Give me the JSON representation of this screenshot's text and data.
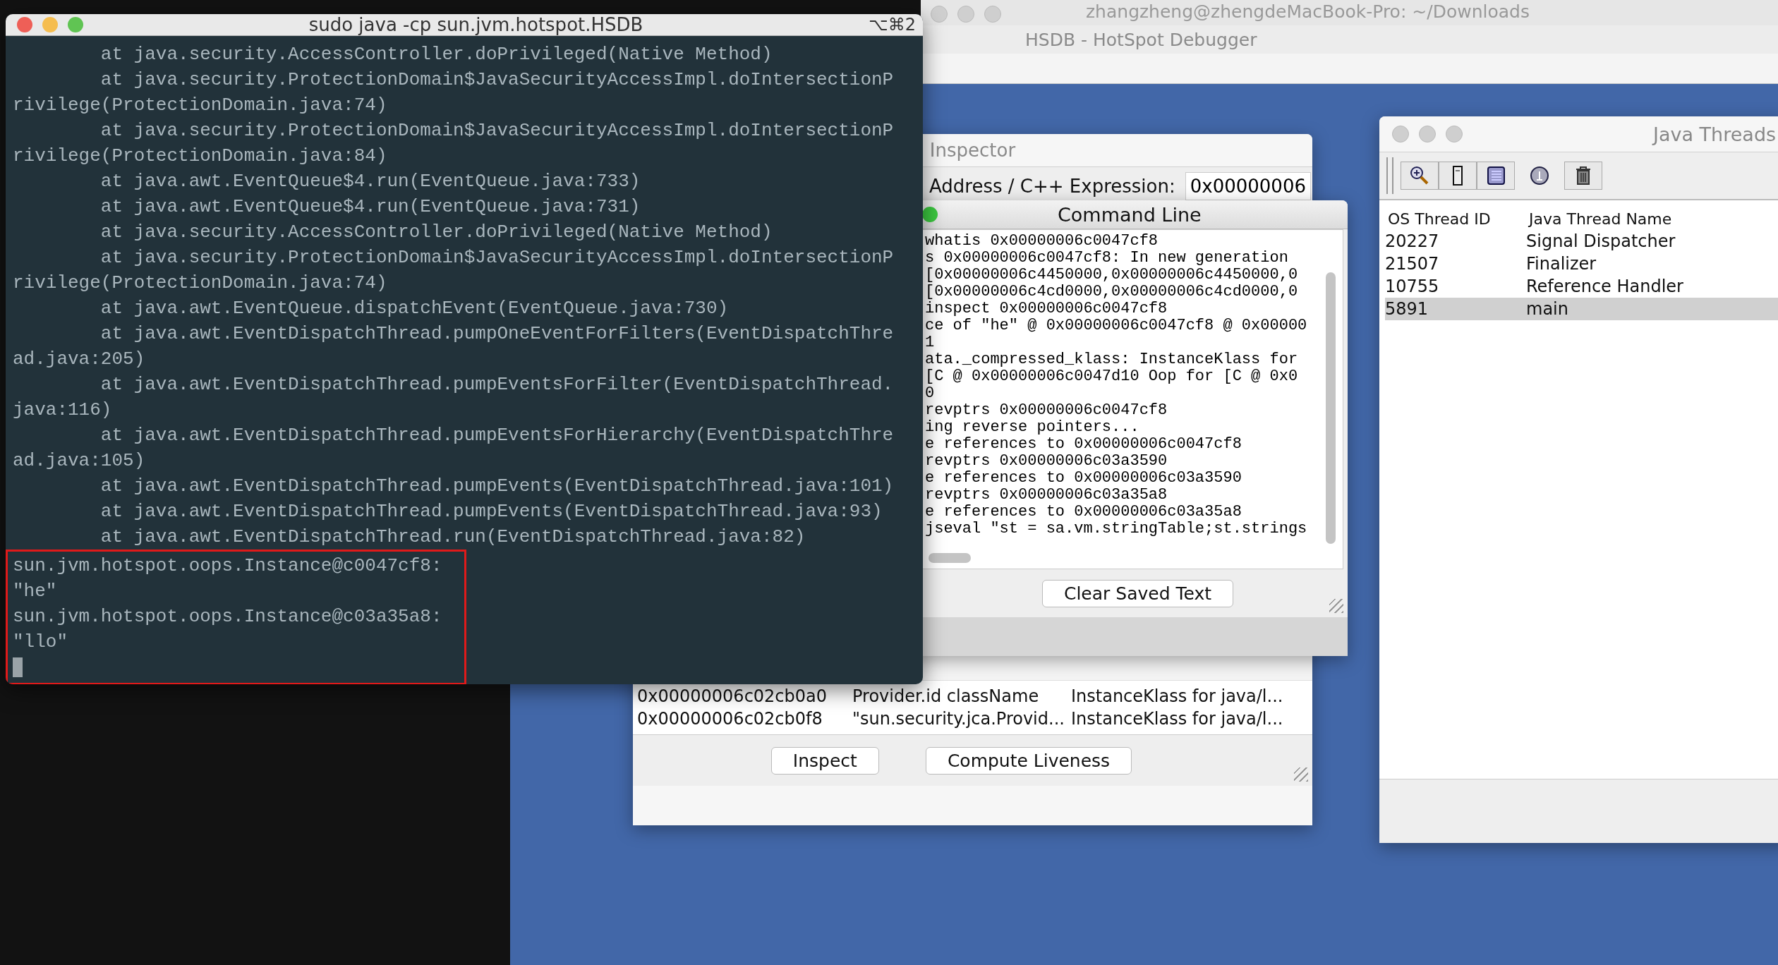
{
  "background_window": {
    "title": "zhangzheng@zhengdeMacBook-Pro: ~/Downloads"
  },
  "hsdb_window": {
    "title": "HSDB - HotSpot Debugger"
  },
  "inspector": {
    "title": "Inspector",
    "address_label": "Address / C++ Expression:",
    "address_value": "0x00000006",
    "rows": [
      [
        "0x00000006c02cb0a0",
        "Provider.id className",
        "InstanceKlass for java/l..."
      ],
      [
        "0x00000006c02cb0f8",
        "\"sun.security.jca.Provid...",
        "InstanceKlass for java/l..."
      ]
    ],
    "buttons": [
      "Inspect",
      "Compute Liveness"
    ]
  },
  "command_line": {
    "title": "Command Line",
    "lines": [
      {
        "text": "whatis 0x00000006c0047cf8"
      },
      {
        "text": "s 0x00000006c0047cf8: In new generation"
      },
      {
        "text": "[0x00000006c4450000,0x00000006c4450000,0"
      },
      {
        "text": "[0x00000006c4cd0000,0x00000006c4cd0000,0"
      },
      {
        "text": "inspect 0x00000006c0047cf8"
      },
      {
        "text": "ce of \"he\" @ 0x00000006c0047cf8 @ 0x00000"
      },
      {
        "text": "1"
      },
      {
        "text": "ata._compressed_klass: InstanceKlass for"
      },
      {
        "text": "[C @ 0x00000006c0047d10 Oop for [C @ 0x0"
      },
      {
        "text": "0"
      },
      {
        "text": "revptrs 0x00000006c0047cf8"
      },
      {
        "text": "ing reverse pointers..."
      },
      {
        "text": "e references to 0x00000006c0047cf8"
      },
      {
        "text": "revptrs 0x00000006c03a3590"
      },
      {
        "text": "e references to 0x00000006c03a3590"
      },
      {
        "text": "revptrs 0x00000006c03a35a8"
      },
      {
        "text": "e references to 0x00000006c03a35a8"
      },
      {
        "text": "jseval \"st = sa.vm.stringTable;st.strings"
      }
    ],
    "button": "Clear Saved Text"
  },
  "java_threads": {
    "title": "Java Threads",
    "columns": [
      "OS Thread ID",
      "Java Thread Name"
    ],
    "rows": [
      {
        "cells": [
          "20227",
          "Signal Dispatcher"
        ],
        "selected": false
      },
      {
        "cells": [
          "21507",
          "Finalizer"
        ],
        "selected": false
      },
      {
        "cells": [
          "10755",
          "Reference Handler"
        ],
        "selected": false
      },
      {
        "cells": [
          "5891",
          "main"
        ],
        "selected": true
      }
    ]
  },
  "terminal": {
    "title": "sudo java -cp  sun.jvm.hotspot.HSDB",
    "shortcut": "⌥⌘2",
    "lines": [
      {
        "kind": "frame",
        "text": "at java.security.AccessController.doPrivileged(Native Method)"
      },
      {
        "kind": "frame",
        "text": "at java.security.ProtectionDomain$JavaSecurityAccessImpl.doIntersectionP"
      },
      {
        "kind": "wrap",
        "text": "rivilege(ProtectionDomain.java:74)"
      },
      {
        "kind": "frame",
        "text": "at java.security.ProtectionDomain$JavaSecurityAccessImpl.doIntersectionP"
      },
      {
        "kind": "wrap",
        "text": "rivilege(ProtectionDomain.java:84)"
      },
      {
        "kind": "frame",
        "text": "at java.awt.EventQueue$4.run(EventQueue.java:733)"
      },
      {
        "kind": "frame",
        "text": "at java.awt.EventQueue$4.run(EventQueue.java:731)"
      },
      {
        "kind": "frame",
        "text": "at java.security.AccessController.doPrivileged(Native Method)"
      },
      {
        "kind": "frame",
        "text": "at java.security.ProtectionDomain$JavaSecurityAccessImpl.doIntersectionP"
      },
      {
        "kind": "wrap",
        "text": "rivilege(ProtectionDomain.java:74)"
      },
      {
        "kind": "frame",
        "text": "at java.awt.EventQueue.dispatchEvent(EventQueue.java:730)"
      },
      {
        "kind": "frame",
        "text": "at java.awt.EventDispatchThread.pumpOneEventForFilters(EventDispatchThre"
      },
      {
        "kind": "wrap",
        "text": "ad.java:205)"
      },
      {
        "kind": "frame",
        "text": "at java.awt.EventDispatchThread.pumpEventsForFilter(EventDispatchThread."
      },
      {
        "kind": "wrap",
        "text": "java:116)"
      },
      {
        "kind": "frame",
        "text": "at java.awt.EventDispatchThread.pumpEventsForHierarchy(EventDispatchThre"
      },
      {
        "kind": "wrap",
        "text": "ad.java:105)"
      },
      {
        "kind": "frame",
        "text": "at java.awt.EventDispatchThread.pumpEvents(EventDispatchThread.java:101)"
      },
      {
        "kind": "frame",
        "text": "at java.awt.EventDispatchThread.pumpEvents(EventDispatchThread.java:93)"
      },
      {
        "kind": "frame",
        "text": "at java.awt.EventDispatchThread.run(EventDispatchThread.java:82)"
      }
    ],
    "highlighted_output": [
      "sun.jvm.hotspot.oops.Instance@c0047cf8:",
      "\"he\"",
      "sun.jvm.hotspot.oops.Instance@c03a35a8:",
      "\"llo\""
    ]
  }
}
